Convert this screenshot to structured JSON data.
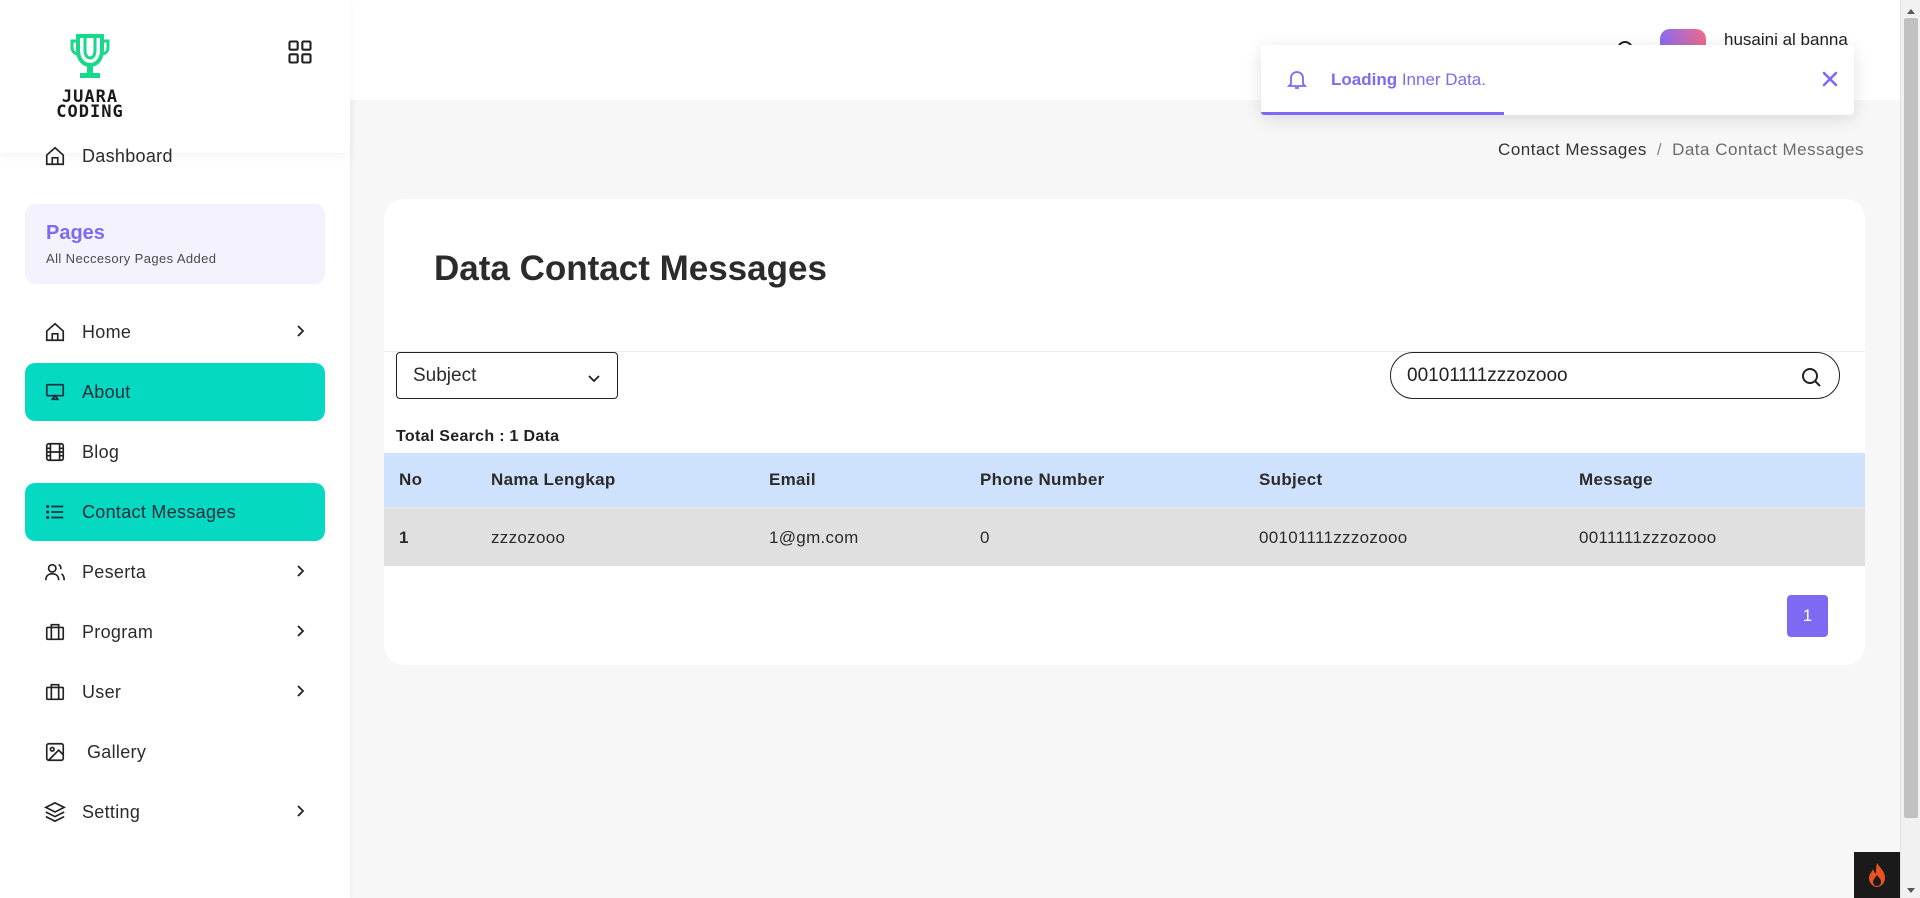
{
  "brand": {
    "logo_text_line1": "JUARA",
    "logo_text_line2": "CODING"
  },
  "sidebar": {
    "dashboard": "Dashboard",
    "pages_title": "Pages",
    "pages_subtitle": "All Neccesory Pages Added",
    "items": [
      {
        "label": "Home",
        "icon": "home-icon",
        "has_chevron": true,
        "active": false
      },
      {
        "label": "About",
        "icon": "monitor-icon",
        "has_chevron": false,
        "active": true
      },
      {
        "label": "Blog",
        "icon": "film-icon",
        "has_chevron": false,
        "active": false
      },
      {
        "label": "Contact Messages",
        "icon": "list-icon",
        "has_chevron": false,
        "active": true
      },
      {
        "label": "Peserta",
        "icon": "users-icon",
        "has_chevron": true,
        "active": false
      },
      {
        "label": "Program",
        "icon": "briefcase-icon",
        "has_chevron": true,
        "active": false
      },
      {
        "label": "User",
        "icon": "briefcase-icon",
        "has_chevron": true,
        "active": false
      },
      {
        "label": "Gallery",
        "icon": "image-icon",
        "has_chevron": false,
        "active": false
      },
      {
        "label": "Setting",
        "icon": "layers-icon",
        "has_chevron": true,
        "active": false
      }
    ]
  },
  "header": {
    "user_name": "husaini al banna"
  },
  "toast": {
    "bold": "Loading",
    "text": " Inner Data.",
    "progress": 0.41
  },
  "breadcrumb": {
    "parent": "Contact Messages",
    "separator": "/",
    "current": "Data Contact Messages"
  },
  "card": {
    "title": "Data Contact Messages",
    "filter_select": "Subject",
    "search_value": "00101111zzzozooo",
    "total_search": "Total Search : 1 Data",
    "columns": [
      "No",
      "Nama Lengkap",
      "Email",
      "Phone Number",
      "Subject",
      "Message"
    ],
    "rows": [
      [
        "1",
        "zzzozooo",
        "1@gm.com",
        "0",
        "00101111zzzozooo",
        "0011111zzzozooo"
      ]
    ],
    "pagination": [
      "1"
    ]
  },
  "colors": {
    "accent": "#7c6af2",
    "active_menu": "#05d9c2",
    "table_header": "#cfe2fd"
  }
}
